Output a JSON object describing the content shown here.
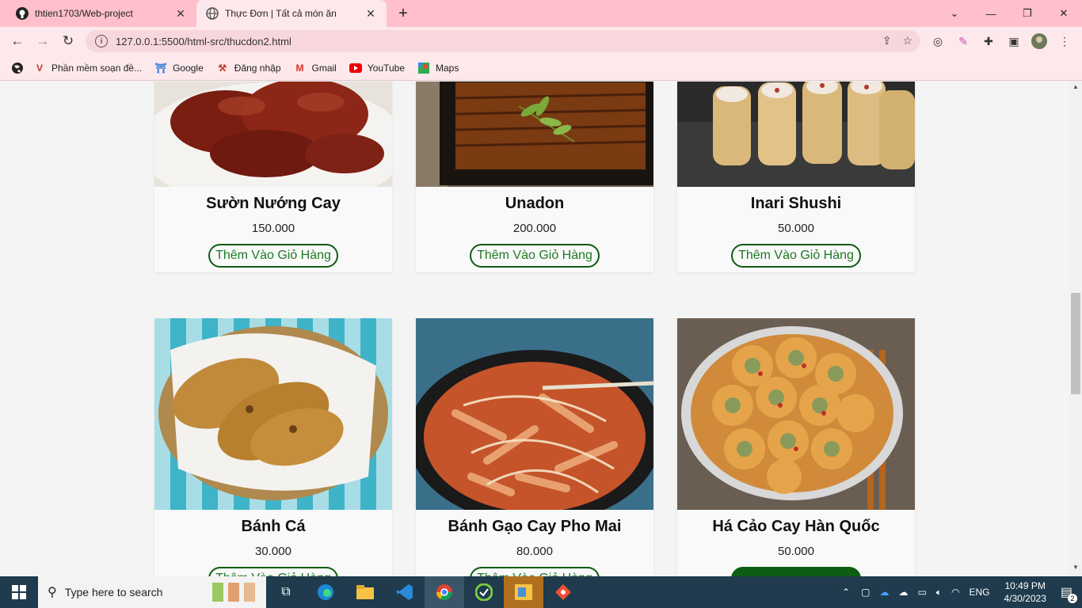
{
  "browser": {
    "tabs": [
      {
        "title": "thtien1703/Web-project",
        "active": false
      },
      {
        "title": "Thực Đơn | Tất cả món ăn",
        "active": true
      }
    ],
    "url": "127.0.0.1:5500/html-src/thucdon2.html",
    "bookmarks": [
      {
        "label": "Phần mềm soạn đề...",
        "icon": "v-logo-icon"
      },
      {
        "label": "Google",
        "icon": "google-icon"
      },
      {
        "label": "Đăng nhập",
        "icon": "login-icon"
      },
      {
        "label": "Gmail",
        "icon": "gmail-icon"
      },
      {
        "label": "YouTube",
        "icon": "youtube-icon"
      },
      {
        "label": "Maps",
        "icon": "maps-icon"
      }
    ]
  },
  "menu": {
    "add_to_cart_label": "Thêm Vào Giỏ Hàng",
    "items": [
      {
        "name": "Sườn Nướng Cay",
        "price": "150.000"
      },
      {
        "name": "Unadon",
        "price": "200.000"
      },
      {
        "name": "Inari Shushi",
        "price": "50.000"
      },
      {
        "name": "Bánh Cá",
        "price": "30.000"
      },
      {
        "name": "Bánh Gạo Cay Pho Mai",
        "price": "80.000"
      },
      {
        "name": "Há Cảo Cay Hàn Quốc",
        "price": "50.000"
      }
    ]
  },
  "taskbar": {
    "search_placeholder": "Type here to search",
    "language": "ENG",
    "time": "10:49 PM",
    "date": "4/30/2023",
    "notification_count": "2"
  },
  "colors": {
    "browser_chrome": "#ffc0cb",
    "button_border": "#0d5d12",
    "button_text": "#1d7a24"
  }
}
